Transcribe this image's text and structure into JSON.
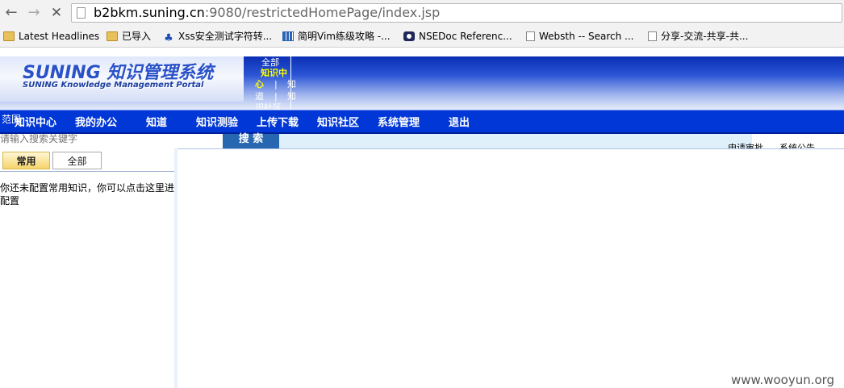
{
  "browser": {
    "url_host": "b2bkm.suning.cn",
    "url_rest": ":9080/restrictedHomePage/index.jsp",
    "bookmarks": [
      {
        "label": "Latest Headlines",
        "icon": "folder-icon"
      },
      {
        "label": "已导入",
        "icon": "folder-icon"
      },
      {
        "label": "Xss安全测试字符转...",
        "icon": "paw-icon"
      },
      {
        "label": "简明Vim练级攻略 -...",
        "icon": "grid-icon"
      },
      {
        "label": "NSEDoc Referenc...",
        "icon": "eye-icon"
      },
      {
        "label": "Websth -- Search ...",
        "icon": "page-icon"
      },
      {
        "label": "分享-交流-共享-共...",
        "icon": "page-icon"
      }
    ]
  },
  "header": {
    "logo_title": "SUNING 知识管理系统",
    "logo_subtitle": "SUNING Knowledge Management Portal",
    "menu": {
      "all": "全部",
      "kc1": "知识中",
      "kc2": "心",
      "bar": "|",
      "zhi": "知",
      "dao": "道",
      "community": "识社区"
    }
  },
  "nav": {
    "scope": "范围",
    "items": [
      "知识中心",
      "我的办公",
      "知道",
      "知识测验",
      "上传下载",
      "知识社区",
      "系统管理",
      "退出"
    ]
  },
  "search": {
    "placeholder": "请输入搜索关键字",
    "button": "搜 索",
    "links": [
      "申请审批",
      "系统公告"
    ]
  },
  "left_panel": {
    "tabs": [
      "常用",
      "全部"
    ],
    "empty_message": "你还未配置常用知识，你可以点击这里进配置"
  },
  "watermark": "www.wooyun.org",
  "colors": {
    "nav_bg": "#0037d6",
    "header_accent": "#0a2fb5",
    "active_menu": "#ffff00",
    "search_button": "#2766b0"
  }
}
